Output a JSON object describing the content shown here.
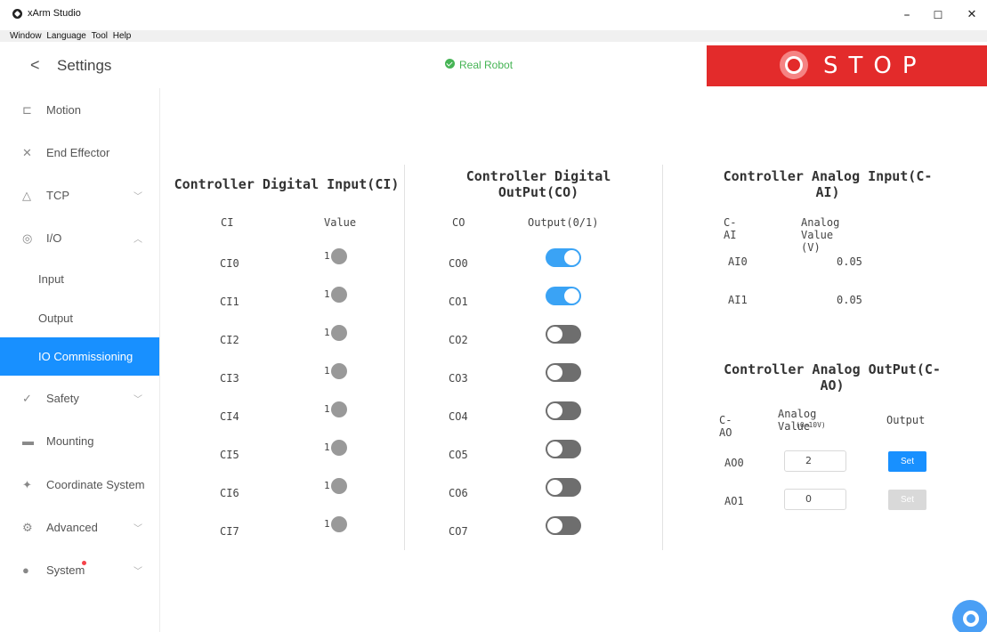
{
  "window": {
    "title": "xArm Studio",
    "minimize": "–",
    "maximize": "☐",
    "close": "✕"
  },
  "menu": [
    "Window",
    "Language",
    "Tool",
    "Help"
  ],
  "header": {
    "back": "<",
    "title": "Settings",
    "status": "Real Robot",
    "stop_label": "STOP"
  },
  "colors": {
    "accent": "#1890ff",
    "stop": "#e32b2b",
    "status_ok": "#46b455",
    "toggle_on": "#3aa3f5",
    "toggle_off": "#6e6e6e"
  },
  "sidebar": {
    "items": [
      {
        "label": "Motion",
        "icon": "motion-icon"
      },
      {
        "label": "End Effector",
        "icon": "end-effector-icon"
      },
      {
        "label": "TCP",
        "icon": "tcp-icon",
        "chevron": "﹀"
      },
      {
        "label": "I/O",
        "icon": "io-icon",
        "chevron": "︿"
      },
      {
        "label": "Input"
      },
      {
        "label": "Output"
      },
      {
        "label": "IO Commissioning",
        "active": true
      },
      {
        "label": "Safety",
        "icon": "safety-icon",
        "chevron": "﹀"
      },
      {
        "label": "Mounting",
        "icon": "mounting-icon"
      },
      {
        "label": "Coordinate System",
        "icon": "coordinate-icon"
      },
      {
        "label": "Advanced",
        "icon": "advanced-icon",
        "chevron": "﹀"
      },
      {
        "label": "System",
        "icon": "system-icon",
        "chevron": "﹀",
        "notification": true
      }
    ]
  },
  "ci": {
    "title": "Controller Digital Input(CI)",
    "col1": "CI",
    "col2": "Value",
    "rows": [
      {
        "name": "CI0",
        "value": "1"
      },
      {
        "name": "CI1",
        "value": "1"
      },
      {
        "name": "CI2",
        "value": "1"
      },
      {
        "name": "CI3",
        "value": "1"
      },
      {
        "name": "CI4",
        "value": "1"
      },
      {
        "name": "CI5",
        "value": "1"
      },
      {
        "name": "CI6",
        "value": "1"
      },
      {
        "name": "CI7",
        "value": "1"
      }
    ]
  },
  "co": {
    "title_line1": "Controller Digital",
    "title_line2": "OutPut(CO)",
    "col1": "CO",
    "col2": "Output(0/1)",
    "rows": [
      {
        "name": "CO0",
        "on": true
      },
      {
        "name": "CO1",
        "on": true
      },
      {
        "name": "CO2",
        "on": false
      },
      {
        "name": "CO3",
        "on": false
      },
      {
        "name": "CO4",
        "on": false
      },
      {
        "name": "CO5",
        "on": false
      },
      {
        "name": "CO6",
        "on": false
      },
      {
        "name": "CO7",
        "on": false
      }
    ]
  },
  "cai": {
    "title_line1": "Controller Analog Input(C-",
    "title_line2": "AI)",
    "col1": "C-AI",
    "col2": "Analog Value (V)",
    "rows": [
      {
        "name": "AI0",
        "value": "0.05"
      },
      {
        "name": "AI1",
        "value": "0.05"
      }
    ]
  },
  "cao": {
    "title_line1": "Controller Analog OutPut(C-",
    "title_line2": "AO)",
    "col1": "C-AO",
    "col2": "Analog Value",
    "col2_sub": "(0~10V)",
    "col3": "Output",
    "rows": [
      {
        "name": "AO0",
        "value": "2",
        "button": "Set",
        "enabled": true
      },
      {
        "name": "AO1",
        "value": "0",
        "button": "Set",
        "enabled": false
      }
    ]
  }
}
